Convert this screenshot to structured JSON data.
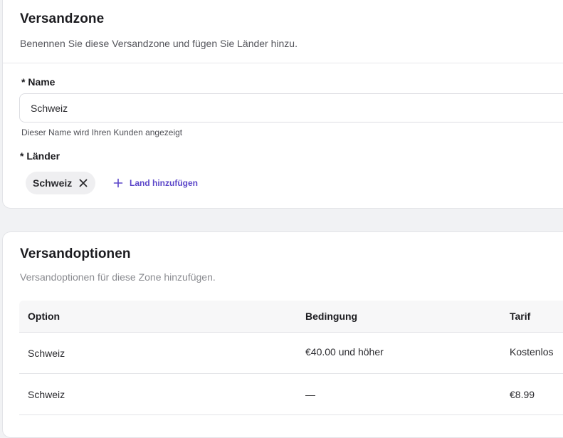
{
  "zone": {
    "title": "Versandzone",
    "subtitle": "Benennen Sie diese Versandzone und fügen Sie Länder hinzu.",
    "name_label": "* Name",
    "name_value": "Schweiz",
    "name_help": "Dieser Name wird Ihren Kunden angezeigt",
    "countries_label": "* Länder",
    "countries": [
      {
        "label": "Schweiz",
        "remove_icon": "close-icon"
      }
    ],
    "add_country_label": "Land hinzufügen",
    "add_country_icon": "plus-icon"
  },
  "options": {
    "title": "Versandoptionen",
    "subtitle": "Versandoptionen für diese Zone hinzufügen.",
    "columns": [
      "Option",
      "Bedingung",
      "Tarif"
    ],
    "rows": [
      {
        "option": "Schweiz",
        "condition": "€40.00 und höher",
        "rate": "Kostenlos"
      },
      {
        "option": "Schweiz",
        "condition": "—",
        "rate": "€8.99"
      }
    ]
  },
  "colors": {
    "accent": "#5b46c9",
    "background": "#f1f2f4",
    "card": "#ffffff"
  }
}
